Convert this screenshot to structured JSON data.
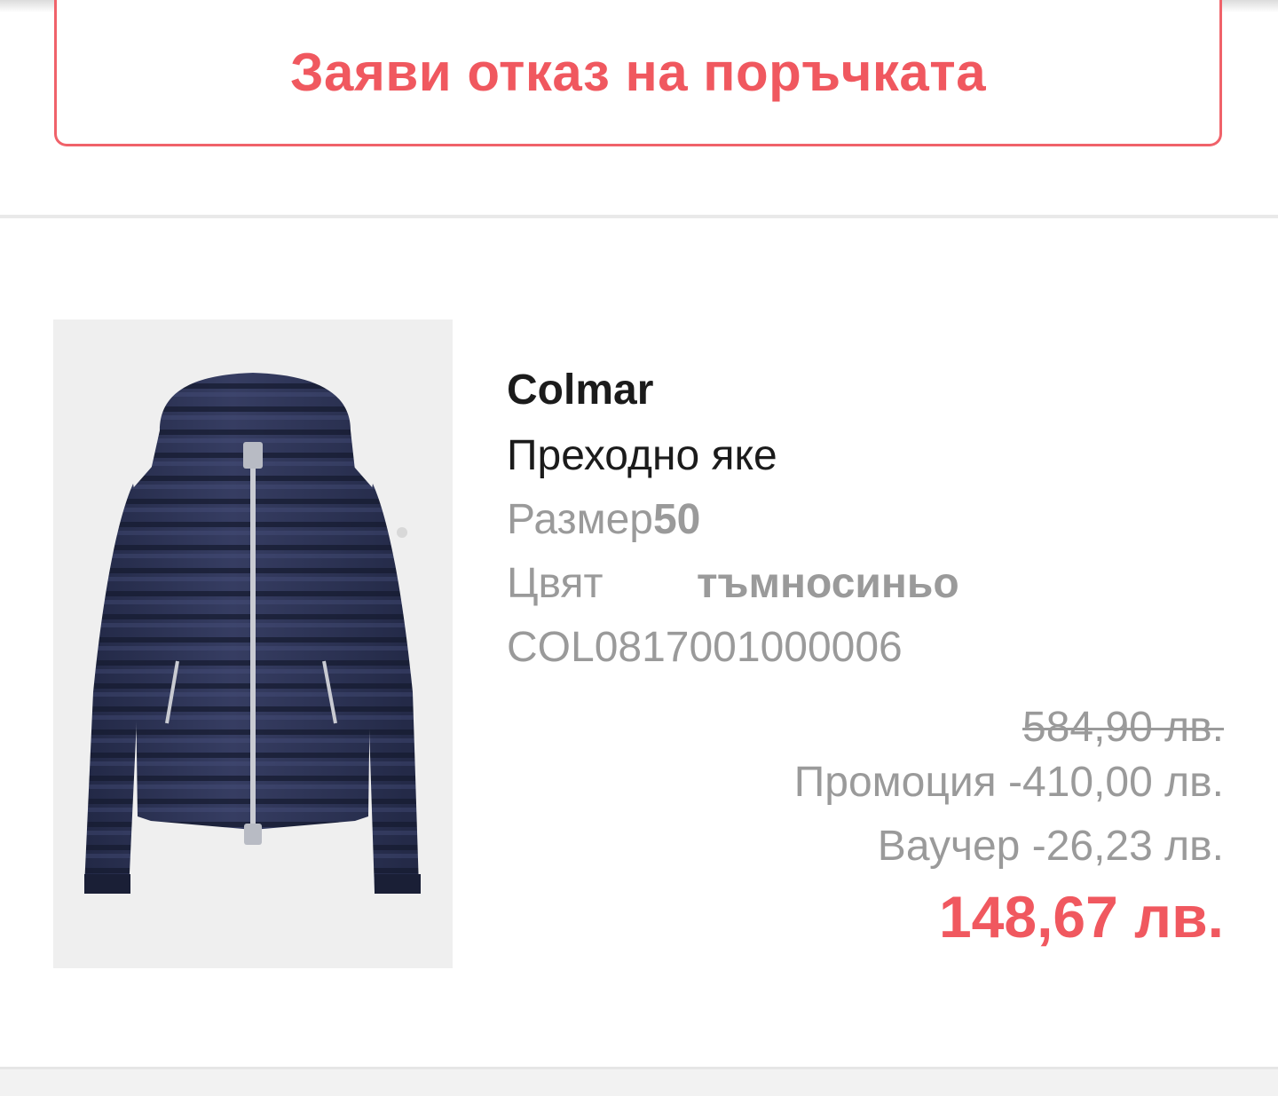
{
  "order": {
    "cancel_label": "Заяви отказ на поръчката"
  },
  "product": {
    "brand": "Colmar",
    "name": "Преходно яке",
    "size_label": "Размер",
    "size_value": "50",
    "color_label": "Цвят",
    "color_value": "тъмносиньо",
    "sku": "COL0817001000006",
    "image_icon": "navy-quilted-jacket-image"
  },
  "pricing": {
    "original_price": "584,90 лв.",
    "promotion_label": "Промоция",
    "promotion_value": "-410,00 лв.",
    "voucher_label": "Ваучер",
    "voucher_value": "-26,23 лв.",
    "final_price": "148,67 лв."
  },
  "colors": {
    "accent": "#f0585f",
    "muted_text": "#9a9a9a",
    "primary_text": "#1b1b1b",
    "jacket": "#2b3150"
  }
}
